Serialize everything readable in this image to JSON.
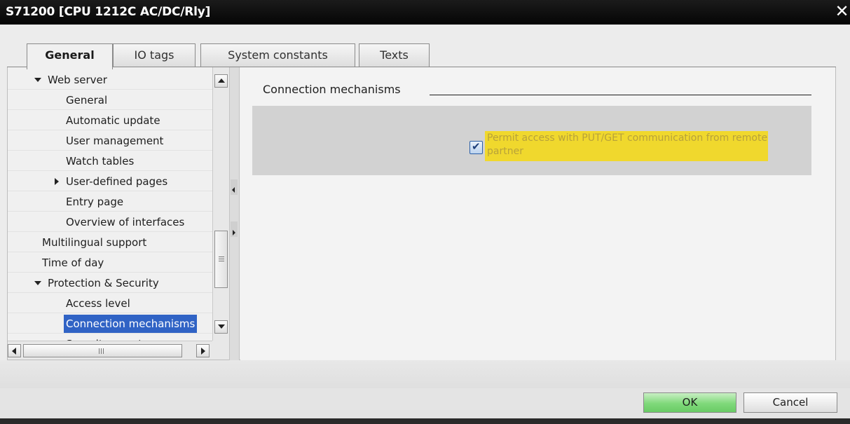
{
  "window": {
    "title": "S71200 [CPU 1212C AC/DC/Rly]",
    "close_symbol": "✕"
  },
  "tabs": [
    {
      "label": "General",
      "active": true
    },
    {
      "label": "IO tags",
      "active": false
    },
    {
      "label": "System constants",
      "active": false
    },
    {
      "label": "Texts",
      "active": false
    }
  ],
  "tree": {
    "items": [
      {
        "label": "Web server",
        "expander": "expanded"
      },
      {
        "label": "General"
      },
      {
        "label": "Automatic update"
      },
      {
        "label": "User management"
      },
      {
        "label": "Watch tables"
      },
      {
        "label": "User-defined pages",
        "expander": "collapsed"
      },
      {
        "label": "Entry page"
      },
      {
        "label": "Overview of interfaces"
      },
      {
        "label": "Multilingual support"
      },
      {
        "label": "Time of day"
      },
      {
        "label": "Protection & Security",
        "expander": "expanded"
      },
      {
        "label": "Access level"
      },
      {
        "label": "Connection mechanisms",
        "selected": true
      },
      {
        "label": "Security event"
      }
    ]
  },
  "content": {
    "section_title": "Connection mechanisms",
    "checkbox": {
      "checked": true,
      "label": "Permit access with PUT/GET communication from remote partner",
      "highlight_color": "#f0d82d"
    }
  },
  "buttons": {
    "ok_label": "OK",
    "cancel_label": "Cancel"
  },
  "colors": {
    "selection": "#3063c5",
    "ok_button": "#7fd97a",
    "titlebar": "#0a0a0a"
  }
}
